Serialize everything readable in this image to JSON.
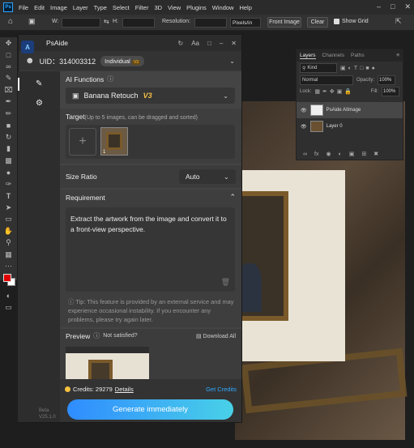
{
  "menubar": {
    "items": [
      "File",
      "Edit",
      "Image",
      "Layer",
      "Type",
      "Select",
      "Filter",
      "3D",
      "View",
      "Plugins",
      "Window",
      "Help"
    ]
  },
  "options_bar": {
    "w_label": "W:",
    "h_label": "H:",
    "resolution_label": "Resolution:",
    "units": "Pixels/in",
    "front_image": "Front Image",
    "clear": "Clear",
    "show_grid": "Show Grid"
  },
  "layers_panel": {
    "tabs": [
      "Layers",
      "Channels",
      "Paths"
    ],
    "kind": "Kind",
    "blend": "Normal",
    "opacity_label": "Opacity:",
    "opacity": "100%",
    "lock_label": "Lock:",
    "fill_label": "Fill:",
    "fill": "100%",
    "layers": [
      {
        "name": "PsAide AIImage",
        "selected": true
      },
      {
        "name": "Layer 0",
        "selected": false
      }
    ]
  },
  "plugin": {
    "title": "PsAide",
    "uid": "UID：314003312",
    "plan": "Individual",
    "plan_badge": "V3",
    "ai_functions_label": "AI Functions",
    "function_name": "Banana Retouch",
    "function_version": "V3",
    "target_label": "Target",
    "target_hint": "(Up to 5 images, can be dragged and sorted)",
    "target_count": "1",
    "size_ratio_label": "Size Ratio",
    "size_ratio_value": "Auto",
    "requirement_label": "Requirement",
    "requirement_text": "Extract the artwork from the image and convert it to a front-view perspective.",
    "tip": "Tip: This feature is provided by an external service and may experience occasional instability. If you encounter any problems, please try again later.",
    "preview_label": "Preview",
    "not_satisfied": "Not satisfied?",
    "download_all": "Download All",
    "credits_label": "Credits: 29279",
    "details": "Details",
    "get_credits": "Get Credits",
    "generate": "Generate immediately",
    "beta_label": "Beta",
    "version": "V25.1.0"
  },
  "colors": {
    "accent_blue": "#31a8ff",
    "generate_gradient_start": "#2f8cff",
    "generate_gradient_end": "#49d1e8",
    "credits_coin": "#f6c23e",
    "version_gold": "#f4c046"
  }
}
